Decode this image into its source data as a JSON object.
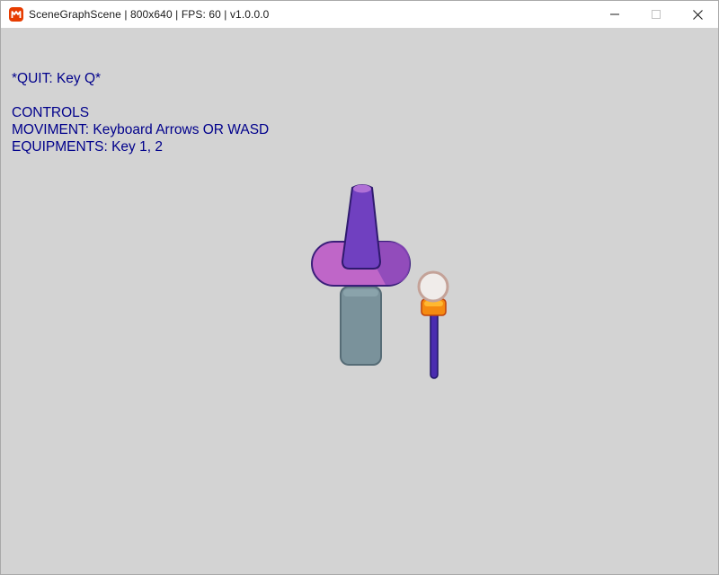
{
  "window": {
    "title": "SceneGraphScene | 800x640 | FPS: 60 | v1.0.0.0",
    "controls": {
      "minimize_icon": "minimize-icon",
      "maximize_icon": "maximize-icon",
      "close_icon": "close-icon"
    }
  },
  "hud": {
    "quit": "*QUIT: Key Q*",
    "controls_heading": "CONTROLS",
    "movement": "MOVIMENT: Keyboard Arrows OR WASD",
    "equipments": "EQUIPMENTS: Key 1, 2"
  },
  "colors": {
    "background": "#d3d3d3",
    "hud_text": "#00008b",
    "hat_brim": "#bf66c8",
    "hat_cone": "#7040c0",
    "body": "#7a929b",
    "staff": "#4a2cb0",
    "staff_orb": "#f0ecea",
    "staff_holder": "#f58a10"
  }
}
